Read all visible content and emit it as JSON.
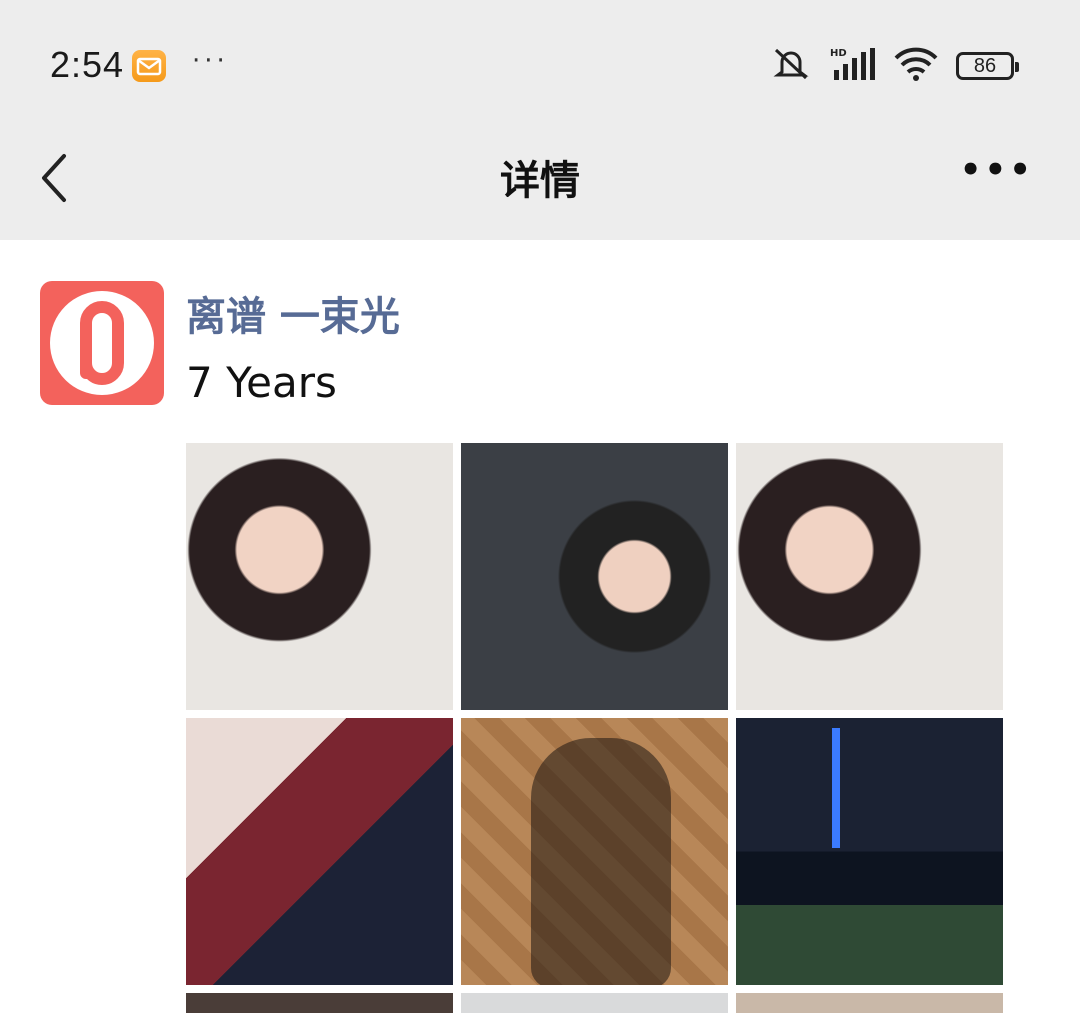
{
  "status_bar": {
    "time": "2:54",
    "more": "···",
    "battery": "86",
    "icons": [
      "mail-icon",
      "mute-icon",
      "hd-signal-icon",
      "wifi-icon",
      "battery-icon"
    ]
  },
  "nav": {
    "title": "详情",
    "back_icon": "chevron-left-icon",
    "more_icon": "more-icon",
    "more_label": "•••"
  },
  "post": {
    "author": "离谱 一束光",
    "text": "7 Years",
    "avatar_color": "#f3625c",
    "photos": [
      {
        "name": "photo-selfie-1"
      },
      {
        "name": "photo-selfie-2"
      },
      {
        "name": "photo-selfie-3"
      },
      {
        "name": "photo-selfie-4"
      },
      {
        "name": "photo-shadows"
      },
      {
        "name": "photo-night-bund"
      }
    ]
  },
  "colors": {
    "bar_bg": "#ededed",
    "link": "#576b95"
  }
}
